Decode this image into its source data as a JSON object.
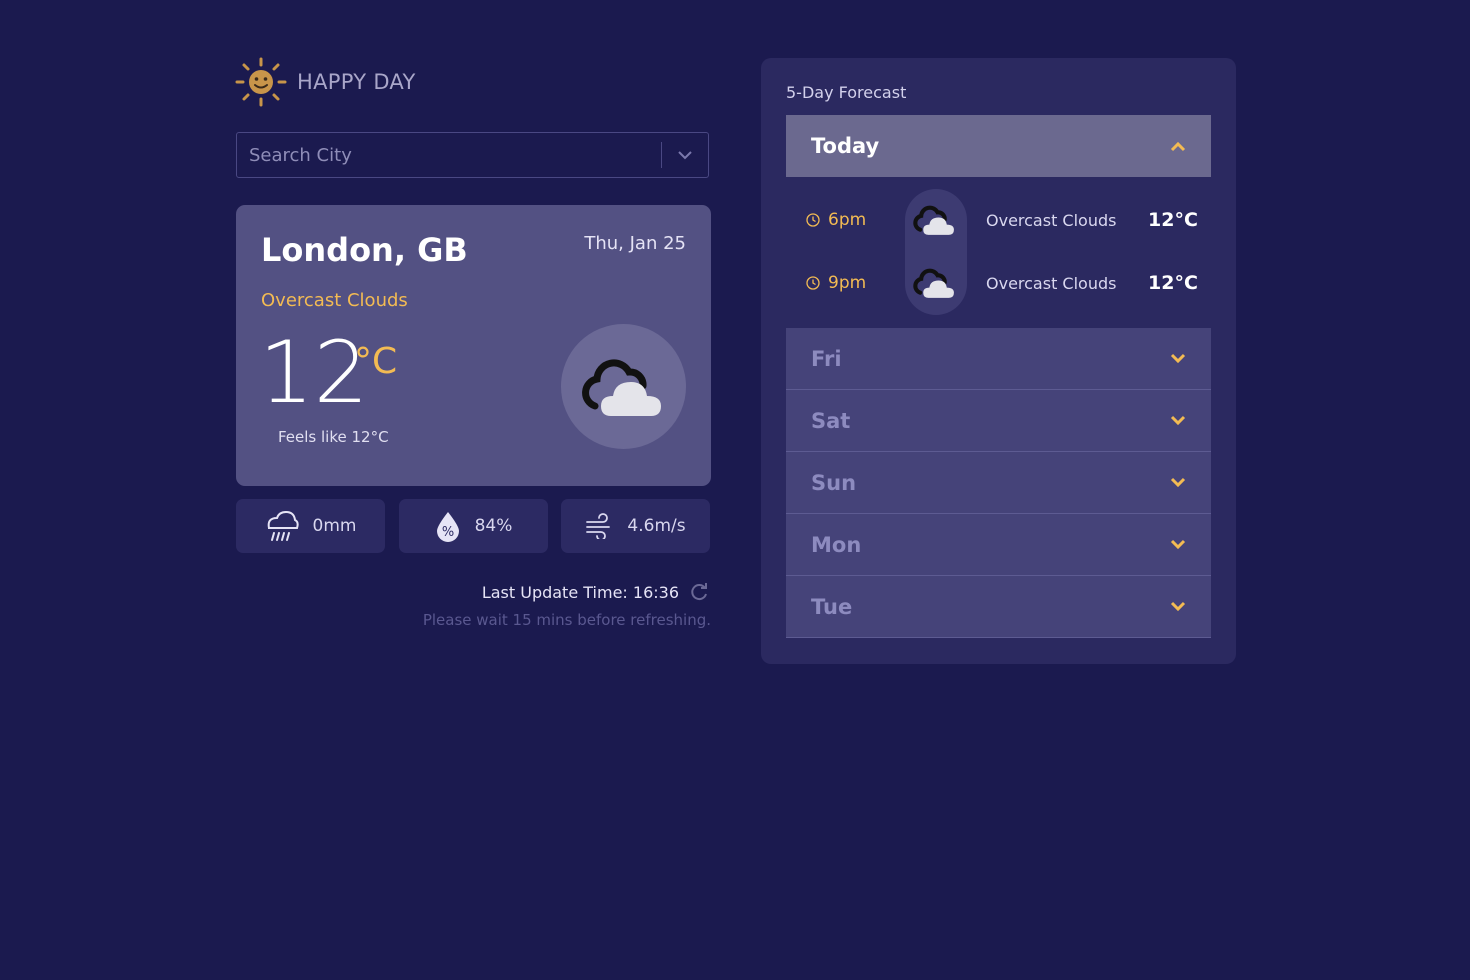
{
  "app": {
    "name": "HAPPY DAY",
    "logo_icon": "smiling-sun-icon"
  },
  "search": {
    "placeholder": "Search City",
    "value": ""
  },
  "current": {
    "city": "London, GB",
    "date": "Thu, Jan 25",
    "description": "Overcast Clouds",
    "temperature": "12",
    "unit": "°C",
    "feels_like": "Feels like 12°C",
    "icon": "overcast-clouds-icon"
  },
  "stats": {
    "rain": {
      "value": "0mm",
      "icon": "rain-cloud-icon"
    },
    "humidity": {
      "value": "84%",
      "icon": "humidity-drop-icon"
    },
    "wind": {
      "value": "4.6m/s",
      "icon": "wind-icon"
    }
  },
  "update": {
    "label": "Last Update Time: 16:36",
    "note": "Please wait 15 mins before refreshing."
  },
  "forecast": {
    "title": "5-Day Forecast",
    "days": [
      {
        "label": "Today",
        "open": true,
        "hours": [
          {
            "time": "6pm",
            "description": "Overcast Clouds",
            "temp": "12°C"
          },
          {
            "time": "9pm",
            "description": "Overcast Clouds",
            "temp": "12°C"
          }
        ]
      },
      {
        "label": "Fri",
        "open": false
      },
      {
        "label": "Sat",
        "open": false
      },
      {
        "label": "Sun",
        "open": false
      },
      {
        "label": "Mon",
        "open": false
      },
      {
        "label": "Tue",
        "open": false
      }
    ]
  },
  "colors": {
    "background": "#1b1a4f",
    "card": "#535183",
    "accent": "#f3bb53",
    "panel": "#2b2960"
  }
}
